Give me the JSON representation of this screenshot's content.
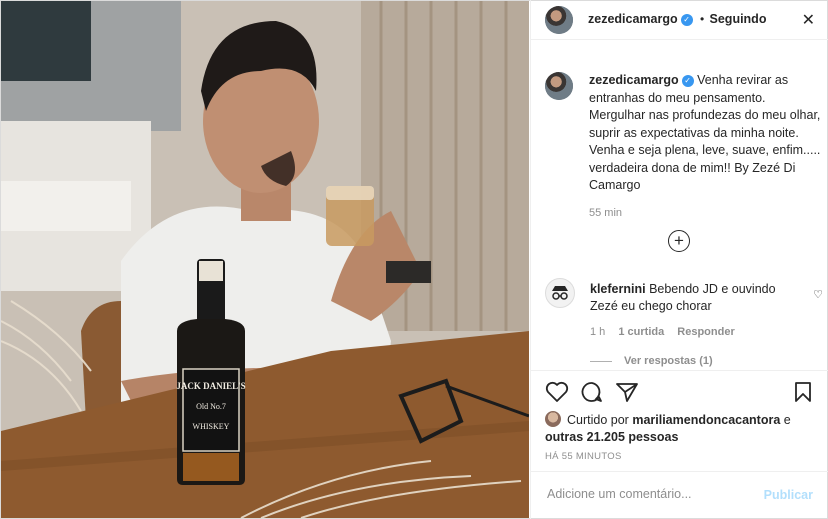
{
  "post": {
    "author": "zezedicamargo",
    "separator": "•",
    "follow_state": "Seguindo",
    "photo_description_icon": "photo",
    "caption": "Venha revirar as entranhas do meu pensamento. Mergulhar nas profundezas do meu olhar, suprir as expectativas da minha noite. Venha e seja plena, leve, suave, enfim..... verdadeira dona de mim!! By Zezé Di Camargo",
    "caption_time": "55 min",
    "photo_bottle_label_top": "JACK DANIEL'S",
    "photo_bottle_label_mid": "Old No.7",
    "photo_bottle_label_bottom": "WHISKEY"
  },
  "comments": [
    {
      "user": "klefernini",
      "text": "Bebendo JD e ouvindo Zezé eu chego chorar",
      "time": "1 h",
      "likes": "1 curtida",
      "reply_label": "Responder",
      "view_replies": "Ver respostas (1)"
    }
  ],
  "likes": {
    "prefix": "Curtido por",
    "user": "mariliamendoncacantora",
    "connector": "e",
    "others": "outras 21.205 pessoas"
  },
  "posted_ago": "HÁ 55 MINUTOS",
  "add_comment": {
    "placeholder": "Adicione um comentário...",
    "publish_label": "Publicar"
  },
  "colors": {
    "verified": "#3897f0",
    "publish_disabled": "#b2dffc",
    "secondary_text": "#8e8e8e"
  }
}
